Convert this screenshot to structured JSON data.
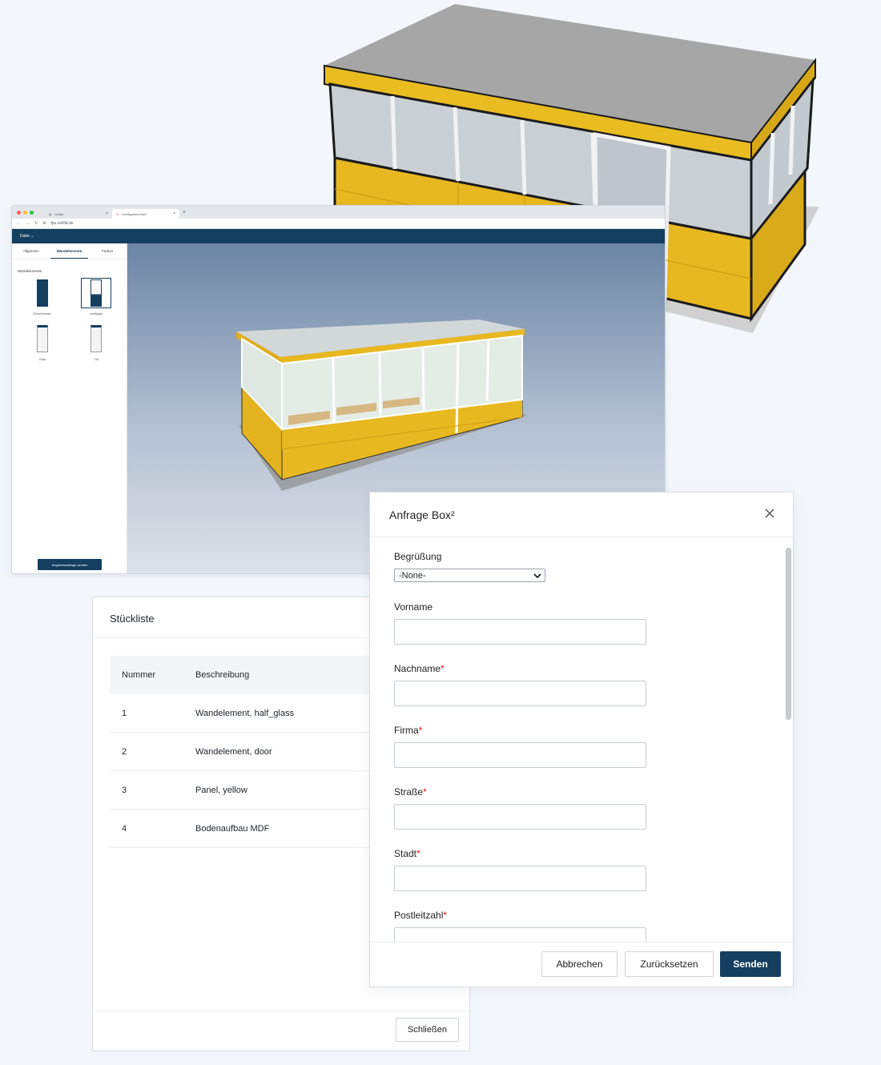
{
  "colors": {
    "primary": "#153f5f",
    "panel_yellow": "#e8b821",
    "roof_gray": "#a6a6a6",
    "required": "#dd1111"
  },
  "browser": {
    "tabs": [
      {
        "label": "cell3d",
        "icon": "globe-icon"
      },
      {
        "label": "Konfigurator Box²",
        "icon": "app-logo-icon"
      }
    ],
    "url": "fps.cell3d.de",
    "menu": {
      "file_label": "Datei ⌄"
    },
    "sidebar": {
      "tabs": [
        "Allgemein",
        "Wandelemente",
        "Farben"
      ],
      "active_tab": "Wandelemente",
      "section_title": "Wandelemente",
      "elements": [
        {
          "label": "Geschlossen",
          "icon": "closed-panel-icon"
        },
        {
          "label": "Halbglas",
          "icon": "half-glass-panel-icon",
          "selected": true
        },
        {
          "label": "Glas",
          "icon": "glass-panel-icon"
        },
        {
          "label": "Tür",
          "icon": "door-panel-icon"
        }
      ],
      "submit_label": "Angebotsanfrage senden"
    }
  },
  "stueckliste": {
    "title": "Stückliste",
    "columns": [
      "Nummer",
      "Beschreibung"
    ],
    "rows": [
      {
        "nummer": "1",
        "beschreibung": "Wandelement, half_glass"
      },
      {
        "nummer": "2",
        "beschreibung": "Wandelement, door"
      },
      {
        "nummer": "3",
        "beschreibung": "Panel, yellow"
      },
      {
        "nummer": "4",
        "beschreibung": "Bodenaufbau MDF"
      }
    ],
    "close_label": "Schließen"
  },
  "modal": {
    "title": "Anfrage Box²",
    "greeting": {
      "label": "Begrüßung",
      "value": "-None-"
    },
    "fields": [
      {
        "label": "Vorname",
        "required": false,
        "value": ""
      },
      {
        "label": "Nachname",
        "required": true,
        "value": ""
      },
      {
        "label": "Firma",
        "required": true,
        "value": ""
      },
      {
        "label": "Straße",
        "required": true,
        "value": ""
      },
      {
        "label": "Stadt",
        "required": true,
        "value": ""
      },
      {
        "label": "Postleitzahl",
        "required": true,
        "value": ""
      }
    ],
    "required_marker": "*",
    "buttons": {
      "cancel": "Abbrechen",
      "reset": "Zurücksetzen",
      "send": "Senden"
    }
  }
}
